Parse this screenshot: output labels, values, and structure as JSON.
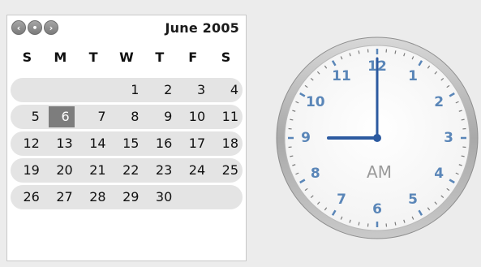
{
  "calendar": {
    "month_label": "June 2005",
    "nav": [
      {
        "name": "previous-month-button",
        "glyph": "‹"
      },
      {
        "name": "today-button",
        "glyph": "•"
      },
      {
        "name": "next-month-button",
        "glyph": "›"
      }
    ],
    "weekdays": [
      "S",
      "M",
      "T",
      "W",
      "T",
      "F",
      "S"
    ],
    "weeks": [
      [
        "",
        "",
        "",
        "1",
        "2",
        "3",
        "4"
      ],
      [
        "5",
        "6",
        "7",
        "8",
        "9",
        "10",
        "11"
      ],
      [
        "12",
        "13",
        "14",
        "15",
        "16",
        "17",
        "18"
      ],
      [
        "19",
        "20",
        "21",
        "22",
        "23",
        "24",
        "25"
      ],
      [
        "26",
        "27",
        "28",
        "29",
        "30",
        "",
        ""
      ]
    ],
    "selected_day": "6"
  },
  "clock": {
    "ampm": "AM",
    "hour_numbers": [
      "12",
      "1",
      "2",
      "3",
      "4",
      "5",
      "6",
      "7",
      "8",
      "9",
      "10",
      "11"
    ],
    "time": {
      "hour": 9,
      "minute": 0
    },
    "colors": {
      "numbers": "#5a86b8",
      "hands": "#2c5aa0",
      "rim": "#9b9b9b"
    }
  }
}
